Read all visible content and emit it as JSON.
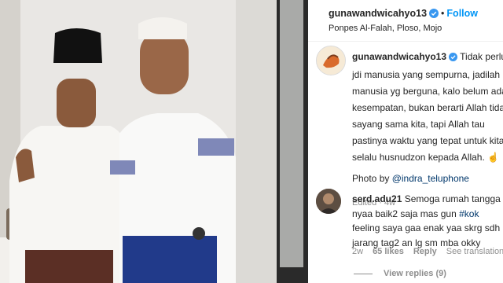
{
  "header": {
    "username": "gunawandwicahyo13",
    "separator": "•",
    "follow_label": "Follow",
    "location": "Ponpes Al-Falah, Ploso, Mojo"
  },
  "caption": {
    "username": "gunawandwicahyo13",
    "lines": [
      "Tidak perlu",
      "jdi manusia yang sempurna, jadilah",
      "manusia yg berguna, kalo belum ada",
      "kesempatan, bukan berarti Allah tidak",
      "sayang sama kita, tapi Allah tau",
      "pastinya waktu yang tepat untuk kita,",
      "selalu husnudzon kepada Allah. ☝️ ☝️"
    ],
    "photo_by_prefix": "Photo by ",
    "photo_by_mention": "@indra_teluphone",
    "edited": "Edited · 4w"
  },
  "comment": {
    "username": "serd.adu21",
    "lines": [
      "Semoga rumah tangga",
      "nyaa baik2 saja mas gun ",
      "feeling saya gaa enak yaa skrg sdh",
      "jarang tag2 an lg sm mba okky"
    ],
    "hashtag": "#kok",
    "age": "2w",
    "likes": "65 likes",
    "reply_label": "Reply",
    "translate_label": "See translation",
    "view_replies": "View replies (9)"
  },
  "colors": {
    "accent": "#0095f6",
    "verified": "#3897f0",
    "text": "#262626",
    "muted": "#8e8e8e",
    "mention": "#00376b"
  },
  "icons": {
    "verified": "verified-badge-icon",
    "heart": "heart-icon"
  }
}
